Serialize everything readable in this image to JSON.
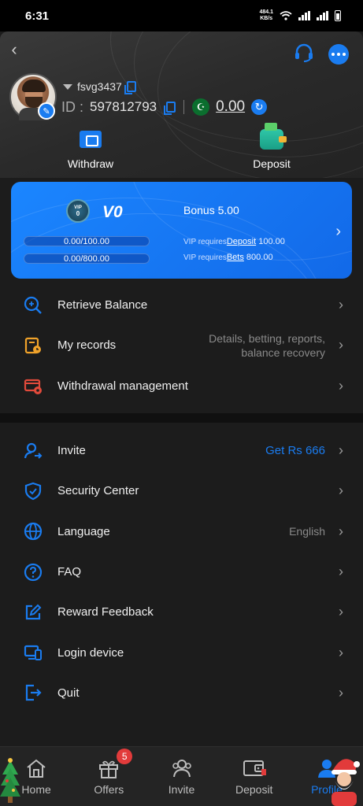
{
  "status_bar": {
    "time": "6:31",
    "net_speed_value": "484.1",
    "net_speed_unit": "KB/s"
  },
  "profile": {
    "username": "fsvg3437",
    "id_label": "ID :",
    "id_value": "597812793",
    "balance": "0.00"
  },
  "actions": {
    "withdraw": "Withdraw",
    "deposit": "Deposit"
  },
  "vip": {
    "badge_top": "VIP",
    "badge_num": "0",
    "level": "V0",
    "bonus": "Bonus 5.00",
    "progress1": "0.00/100.00",
    "progress2": "0.00/800.00",
    "req_prefix": "VIP requires",
    "req1_link": "Deposit",
    "req1_value": "100.00",
    "req2_link": "Bets",
    "req2_value": "800.00"
  },
  "menu_top": [
    {
      "label": "Retrieve Balance",
      "extra": ""
    },
    {
      "label": "My records",
      "extra_line1": "Details, betting, reports,",
      "extra_line2": "balance recovery"
    },
    {
      "label": "Withdrawal management",
      "extra": ""
    }
  ],
  "menu_bottom": [
    {
      "label": "Invite",
      "extra": "Get Rs 666"
    },
    {
      "label": "Security Center",
      "extra": ""
    },
    {
      "label": "Language",
      "extra": "English"
    },
    {
      "label": "FAQ",
      "extra": ""
    },
    {
      "label": "Reward Feedback",
      "extra": ""
    },
    {
      "label": "Login device",
      "extra": ""
    },
    {
      "label": "Quit",
      "extra": ""
    }
  ],
  "bottom_nav": {
    "home": "Home",
    "offers": "Offers",
    "offers_badge": "5",
    "invite": "Invite",
    "deposit": "Deposit",
    "profile": "Profile"
  },
  "colors": {
    "accent": "#1a7cf0",
    "background": "#1c1c1c",
    "vip_card": "#1b86ff"
  }
}
